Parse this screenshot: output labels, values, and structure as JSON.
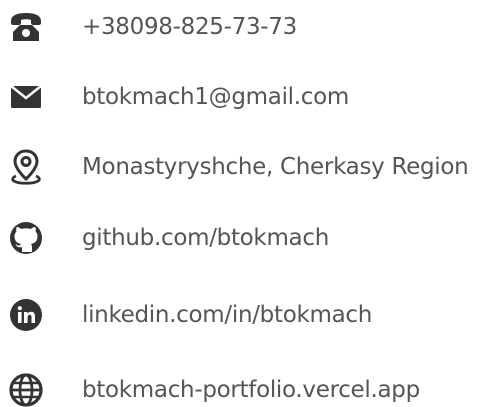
{
  "contacts": {
    "phone": {
      "icon": "phone-icon",
      "text": "+38098-825-73-73"
    },
    "email": {
      "icon": "envelope-icon",
      "text": "btokmach1@gmail.com"
    },
    "location": {
      "icon": "location-pin-icon",
      "text": "Monastyryshche, Cherkasy Region"
    },
    "github": {
      "icon": "github-icon",
      "text": "github.com/btokmach"
    },
    "linkedin": {
      "icon": "linkedin-icon",
      "text": "linkedin.com/in/btokmach"
    },
    "website": {
      "icon": "globe-icon",
      "text": "btokmach-portfolio.vercel.app"
    }
  },
  "colors": {
    "icon": "#333333",
    "text": "#555555",
    "background": "#ffffff"
  }
}
